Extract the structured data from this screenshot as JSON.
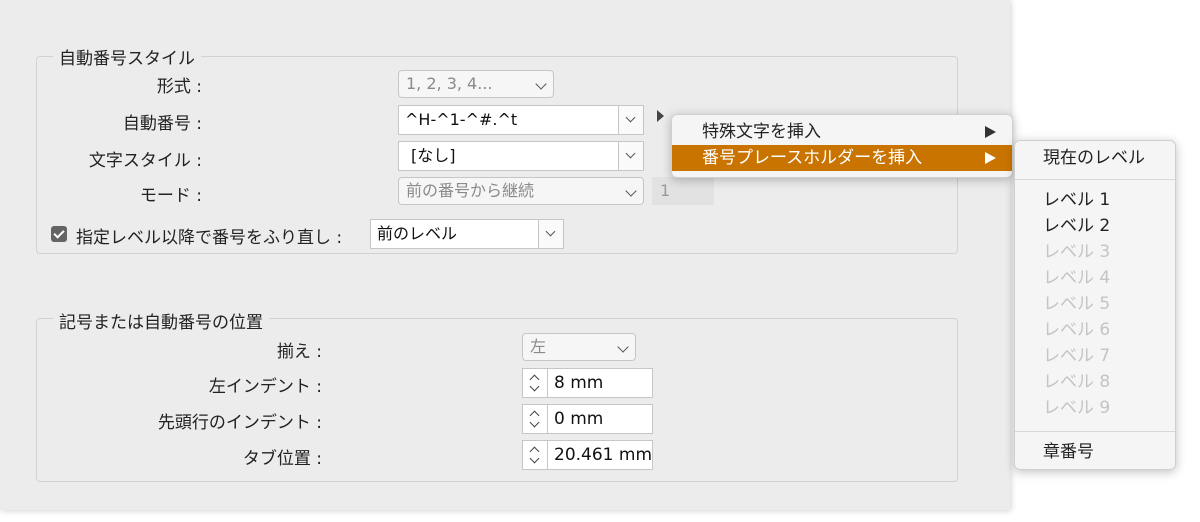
{
  "numbering_group": {
    "title": "自動番号スタイル",
    "format_label": "形式 :",
    "format_value": "1, 2, 3, 4...",
    "number_label": "自動番号 :",
    "number_value": "^H-^1-^#.^t",
    "char_style_label": "文字スタイル :",
    "char_style_value": "[なし]",
    "mode_label": "モード :",
    "mode_value": "前の番号から継続",
    "mode_start_value": "1",
    "restart_checked": true,
    "restart_label": "指定レベル以降で番号をふり直し :",
    "restart_value": "前のレベル"
  },
  "position_group": {
    "title": "記号または自動番号の位置",
    "align_label": "揃え :",
    "align_value": "左",
    "left_indent_label": "左インデント :",
    "left_indent_value": "8 mm",
    "first_indent_label": "先頭行のインデント :",
    "first_indent_value": "0 mm",
    "tab_label": "タブ位置 :",
    "tab_value": "20.461 mm"
  },
  "context_menu": {
    "items": [
      {
        "label": "特殊文字を挿入",
        "highlighted": false
      },
      {
        "label": "番号プレースホルダーを挿入",
        "highlighted": true
      }
    ]
  },
  "submenu": {
    "current_level": "現在のレベル",
    "levels": [
      {
        "label": "レベル 1",
        "enabled": true
      },
      {
        "label": "レベル 2",
        "enabled": true
      },
      {
        "label": "レベル 3",
        "enabled": false
      },
      {
        "label": "レベル 4",
        "enabled": false
      },
      {
        "label": "レベル 5",
        "enabled": false
      },
      {
        "label": "レベル 6",
        "enabled": false
      },
      {
        "label": "レベル 7",
        "enabled": false
      },
      {
        "label": "レベル 8",
        "enabled": false
      },
      {
        "label": "レベル 9",
        "enabled": false
      }
    ],
    "chapter_number": "章番号"
  },
  "colors": {
    "highlight": "#c97400",
    "dialog_bg": "#ececec"
  }
}
